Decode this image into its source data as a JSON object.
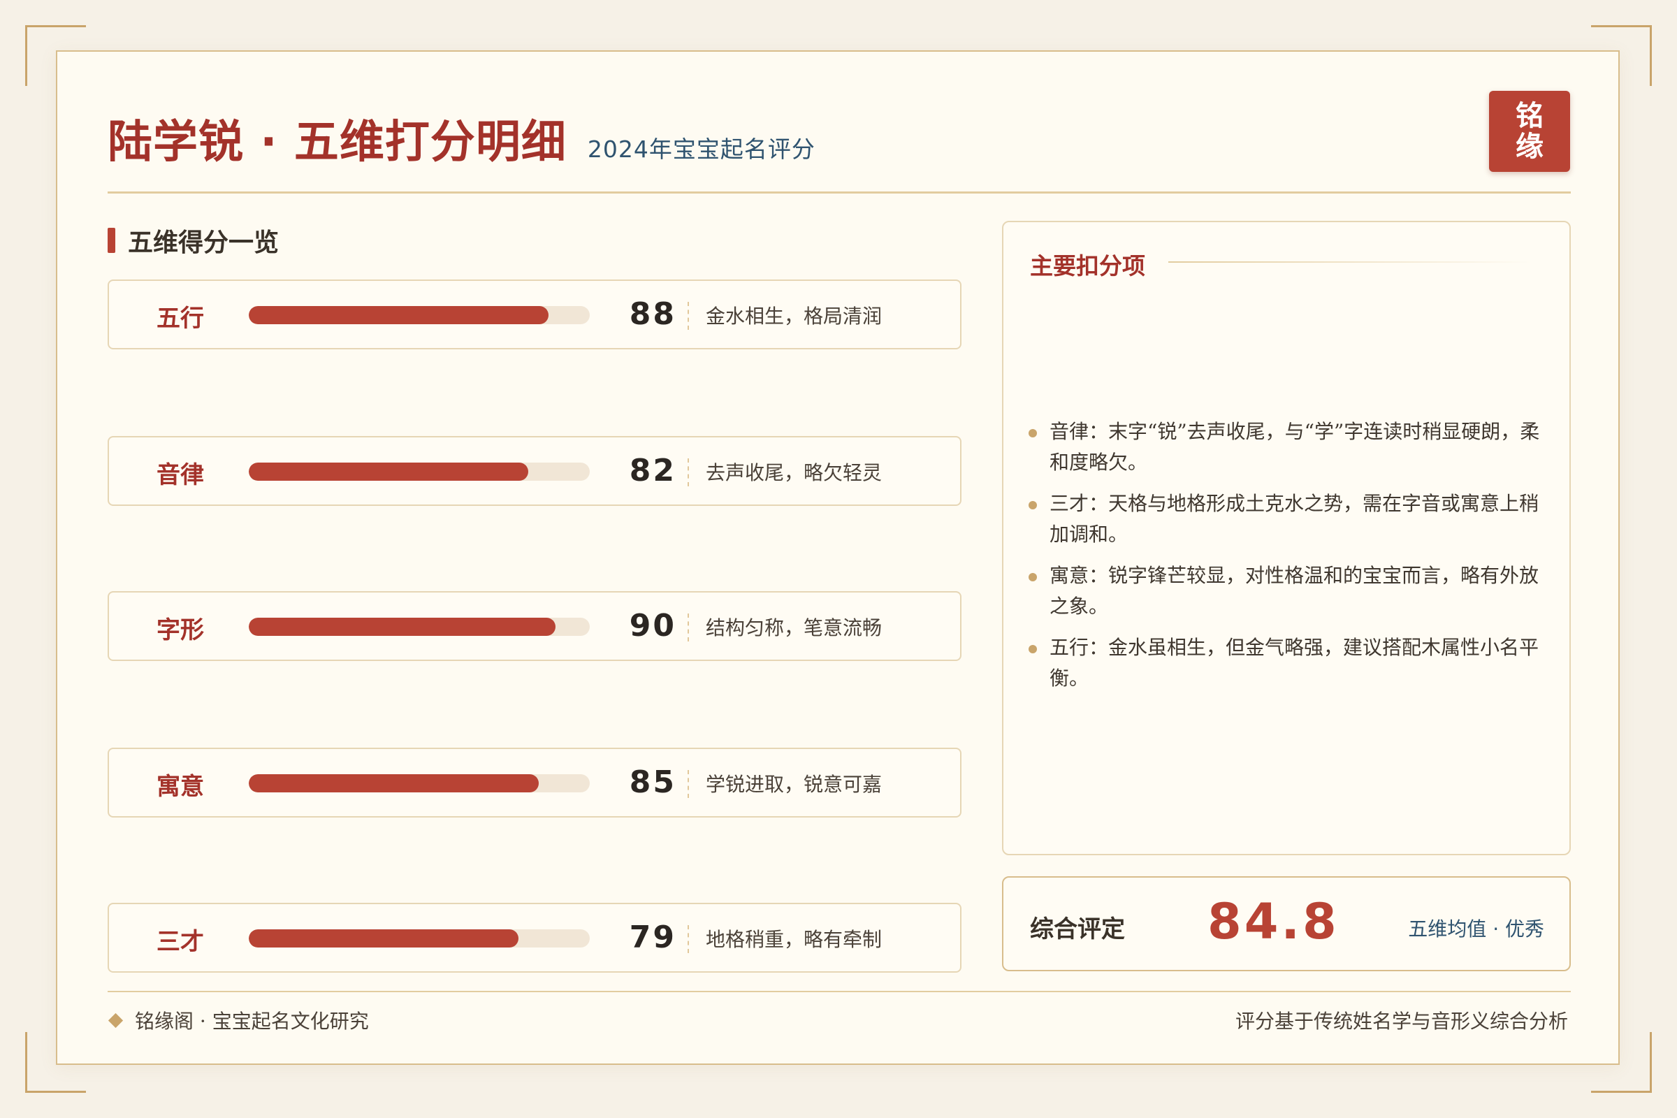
{
  "header": {
    "title": "陆学锐 · 五维打分明细",
    "subtitle": "2024年宝宝起名评分",
    "seal": [
      "铭",
      "缘"
    ]
  },
  "section": {
    "title": "五维得分一览"
  },
  "scores": [
    {
      "label": "五行",
      "score": 88,
      "note": "金水相生，格局清润"
    },
    {
      "label": "音律",
      "score": 82,
      "note": "去声收尾，略欠轻灵"
    },
    {
      "label": "字形",
      "score": 90,
      "note": "结构匀称，笔意流畅"
    },
    {
      "label": "寓意",
      "score": 85,
      "note": "学锐进取，锐意可嘉"
    },
    {
      "label": "三才",
      "score": 79,
      "note": "地格稍重，略有牵制"
    }
  ],
  "deductions": {
    "title": "主要扣分项",
    "items": [
      "音律：末字“锐”去声收尾，与“学”字连读时稍显硬朗，柔和度略欠。",
      "三才：天格与地格形成土克水之势，需在字音或寓意上稍加调和。",
      "寓意：锐字锋芒较显，对性格温和的宝宝而言，略有外放之象。",
      "五行：金水虽相生，但金气略强，建议搭配木属性小名平衡。"
    ]
  },
  "summary": {
    "label": "综合评定",
    "score": "84.8",
    "note": "五维均值 · 优秀"
  },
  "footer": {
    "left": "铭缘阁 · 宝宝起名文化研究",
    "right": "评分基于传统姓名学与音形义综合分析"
  },
  "colors": {
    "accent": "#b84334",
    "title_red": "#a3322a",
    "gold": "#c9a46a",
    "blue": "#2f536f",
    "background": "#fefbf2"
  }
}
